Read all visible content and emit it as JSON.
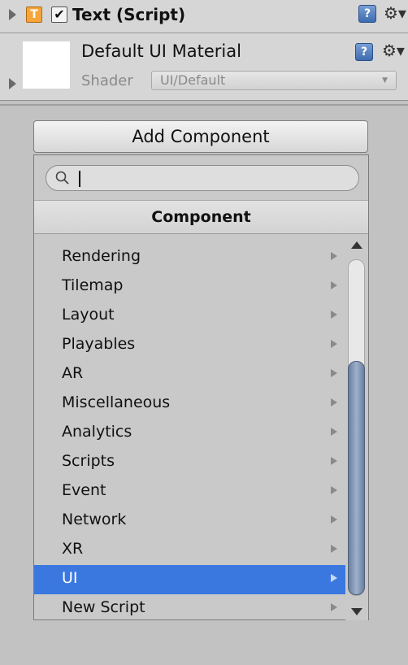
{
  "component": {
    "title": "Text (Script)",
    "icon": "T",
    "enabled_mark": "✔",
    "help": "?",
    "gear": "⚙▾"
  },
  "material": {
    "name": "Default UI Material",
    "shader_label": "Shader",
    "shader_value": "UI/Default",
    "help": "?",
    "gear": "⚙▾"
  },
  "add_component": {
    "button_label": "Add Component",
    "search_value": "",
    "group_header": "Component",
    "items": [
      {
        "label": "Rendering"
      },
      {
        "label": "Tilemap"
      },
      {
        "label": "Layout"
      },
      {
        "label": "Playables"
      },
      {
        "label": "AR"
      },
      {
        "label": "Miscellaneous"
      },
      {
        "label": "Analytics"
      },
      {
        "label": "Scripts"
      },
      {
        "label": "Event"
      },
      {
        "label": "Network"
      },
      {
        "label": "XR"
      },
      {
        "label": "UI"
      },
      {
        "label": "New Script"
      }
    ],
    "selected_index": 11,
    "selected_color": "#3a78e0",
    "scroll_position": 0.4,
    "scroll_visible_fraction": 0.7
  }
}
